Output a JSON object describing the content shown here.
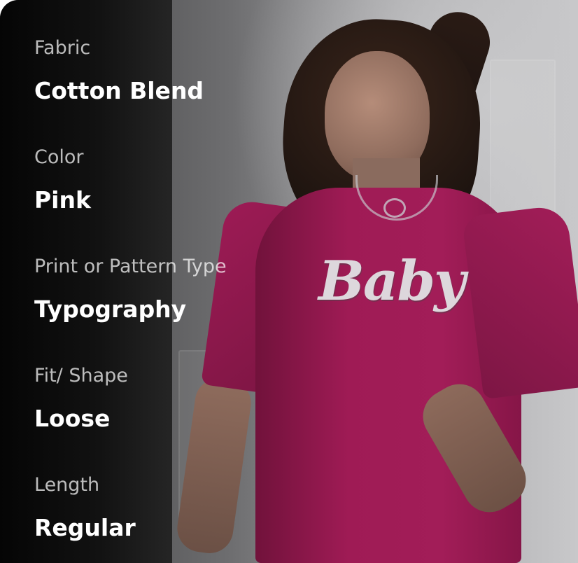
{
  "product_details": [
    {
      "label": "Fabric",
      "value": "Cotton Blend"
    },
    {
      "label": "Color",
      "value": "Pink"
    },
    {
      "label": "Print or Pattern Type",
      "value": "Typography"
    },
    {
      "label": "Fit/ Shape",
      "value": "Loose"
    },
    {
      "label": "Length",
      "value": "Regular"
    }
  ],
  "product_image": {
    "subject": "model wearing oversized t-shirt",
    "shirt_text": "Baby",
    "shirt_color": "#9f1b55",
    "print_color": "#ddd7dc"
  },
  "colors": {
    "overlay_background": "#050505",
    "label_text": "#ffffffb8",
    "value_text": "#ffffff"
  }
}
